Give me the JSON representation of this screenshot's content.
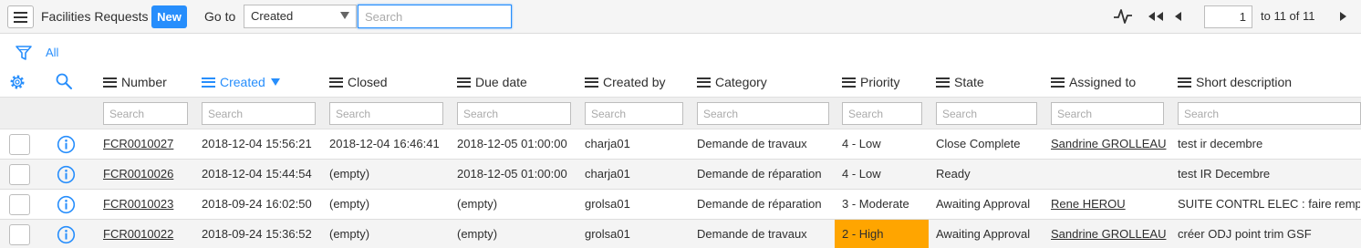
{
  "header": {
    "title": "Facilities Requests",
    "new_label": "New",
    "goto_label": "Go to",
    "goto_selected": "Created",
    "search_placeholder": "Search",
    "page_number": "1",
    "page_range": "to 11 of 11"
  },
  "breadcrumb": {
    "all_label": "All"
  },
  "columns": [
    {
      "label": "Number",
      "sorted": false
    },
    {
      "label": "Created",
      "sorted": true
    },
    {
      "label": "Closed",
      "sorted": false
    },
    {
      "label": "Due date",
      "sorted": false
    },
    {
      "label": "Created by",
      "sorted": false
    },
    {
      "label": "Category",
      "sorted": false
    },
    {
      "label": "Priority",
      "sorted": false
    },
    {
      "label": "State",
      "sorted": false
    },
    {
      "label": "Assigned to",
      "sorted": false
    },
    {
      "label": "Short description",
      "sorted": false
    }
  ],
  "column_search_placeholder": "Search",
  "rows": [
    {
      "number": "FCR0010027",
      "created": "2018-12-04 15:56:21",
      "closed": "2018-12-04 16:46:41",
      "due_date": "2018-12-05 01:00:00",
      "created_by": "charja01",
      "category": "Demande de travaux",
      "priority": "4 - Low",
      "state": "Close Complete",
      "assigned_to": "Sandrine GROLLEAU",
      "short_description": "test ir decembre"
    },
    {
      "number": "FCR0010026",
      "created": "2018-12-04 15:44:54",
      "closed": "(empty)",
      "due_date": "2018-12-05 01:00:00",
      "created_by": "charja01",
      "category": "Demande de réparation",
      "priority": "4 - Low",
      "state": "Ready",
      "assigned_to": "",
      "short_description": "test IR Decembre"
    },
    {
      "number": "FCR0010023",
      "created": "2018-09-24 16:02:50",
      "closed": "(empty)",
      "due_date": "(empty)",
      "created_by": "grolsa01",
      "category": "Demande de réparation",
      "priority": "3 - Moderate",
      "state": "Awaiting Approval",
      "assigned_to": "Rene HEROU",
      "short_description": "SUITE CONTRL ELEC : faire rempla"
    },
    {
      "number": "FCR0010022",
      "created": "2018-09-24 15:36:52",
      "closed": "(empty)",
      "due_date": "(empty)",
      "created_by": "grolsa01",
      "category": "Demande de travaux",
      "priority": "2 - High",
      "state": "Awaiting Approval",
      "assigned_to": "Sandrine GROLLEAU",
      "short_description": "créer ODJ point trim GSF"
    }
  ],
  "colors": {
    "accent": "#278efc",
    "priority_high_bg": "#ffa500"
  },
  "icons": [
    "menu-icon",
    "activity-icon",
    "first-page-icon",
    "prev-page-icon",
    "next-page-icon",
    "filter-icon",
    "gear-icon",
    "search-icon",
    "info-icon",
    "sort-desc-icon"
  ]
}
